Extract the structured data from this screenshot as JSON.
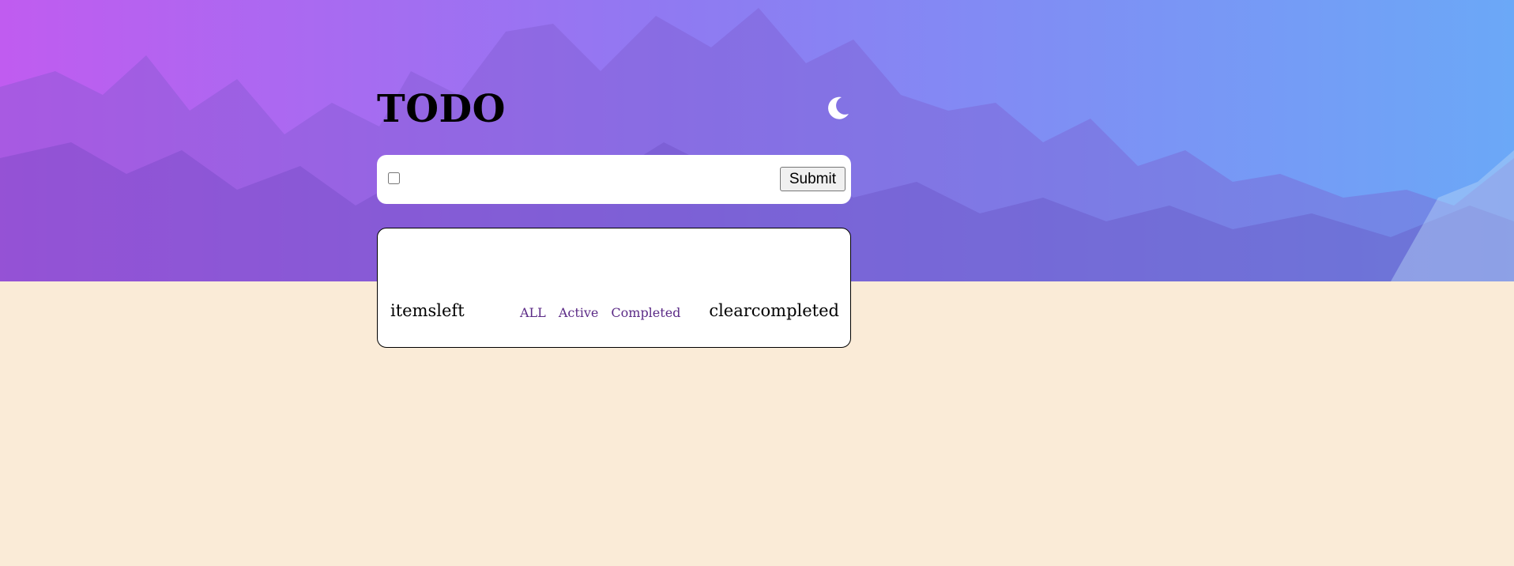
{
  "header": {
    "title": "TODO",
    "theme_icon": "moon-icon"
  },
  "new_todo": {
    "input_value": "",
    "input_placeholder": "",
    "submit_label": "Submit"
  },
  "list": {
    "items": [],
    "items_left_label": "itemsleft",
    "filters": [
      {
        "label": "ALL"
      },
      {
        "label": "Active"
      },
      {
        "label": "Completed"
      }
    ],
    "clear_label": "clearcompleted"
  },
  "colors": {
    "page_background": "#faebd7",
    "hero_gradient_start": "#c05cf0",
    "hero_gradient_end": "#6ba8f7",
    "filter_link": "#5b2a86"
  }
}
